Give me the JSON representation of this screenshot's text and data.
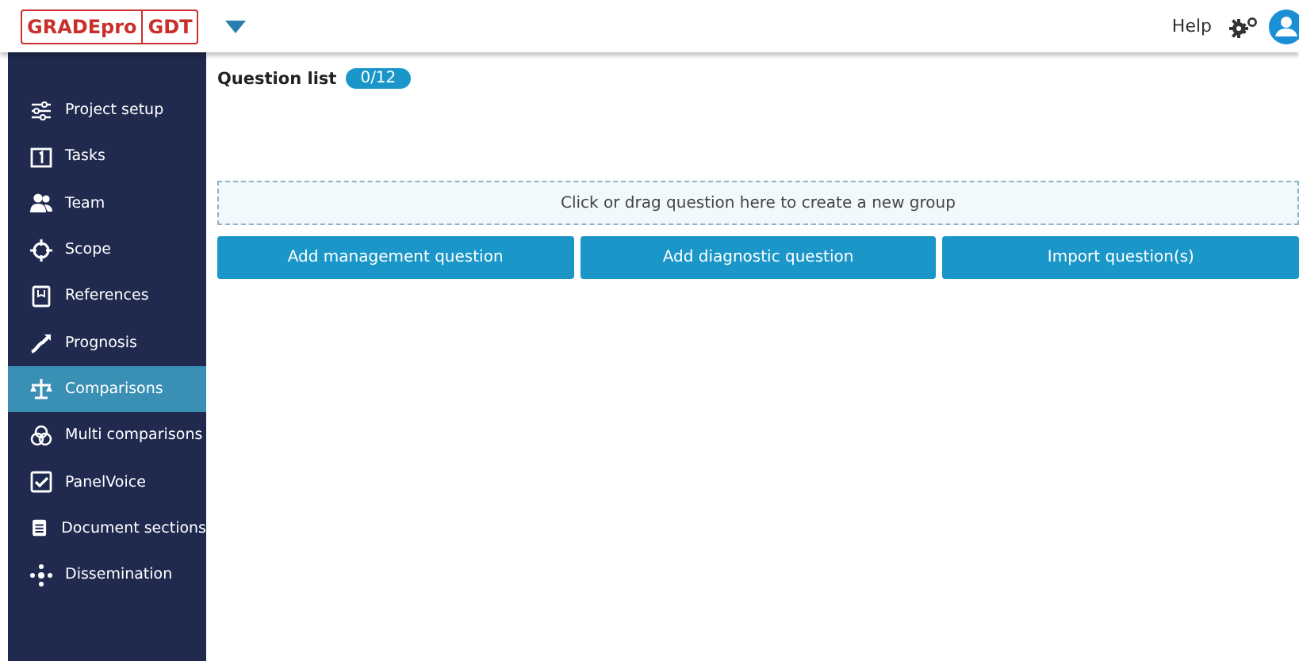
{
  "header": {
    "logo": {
      "name": "GRADEpro",
      "suffix": "GDT"
    },
    "help": "Help"
  },
  "sidebar": {
    "items": [
      {
        "label": "Project setup",
        "selected": false
      },
      {
        "label": "Tasks",
        "selected": false
      },
      {
        "label": "Team",
        "selected": false
      },
      {
        "label": "Scope",
        "selected": false
      },
      {
        "label": "References",
        "selected": false
      },
      {
        "label": "Prognosis",
        "selected": false
      },
      {
        "label": "Comparisons",
        "selected": true
      },
      {
        "label": "Multi comparisons",
        "selected": false
      },
      {
        "label": "PanelVoice",
        "selected": false
      },
      {
        "label": "Document sections",
        "selected": false
      },
      {
        "label": "Dissemination",
        "selected": false
      }
    ]
  },
  "main": {
    "title": "Question list",
    "count": "0/12",
    "drop_zone": "Click or drag question here to create a new group",
    "buttons": [
      "Add management question",
      "Add diagnostic question",
      "Import question(s)"
    ]
  }
}
